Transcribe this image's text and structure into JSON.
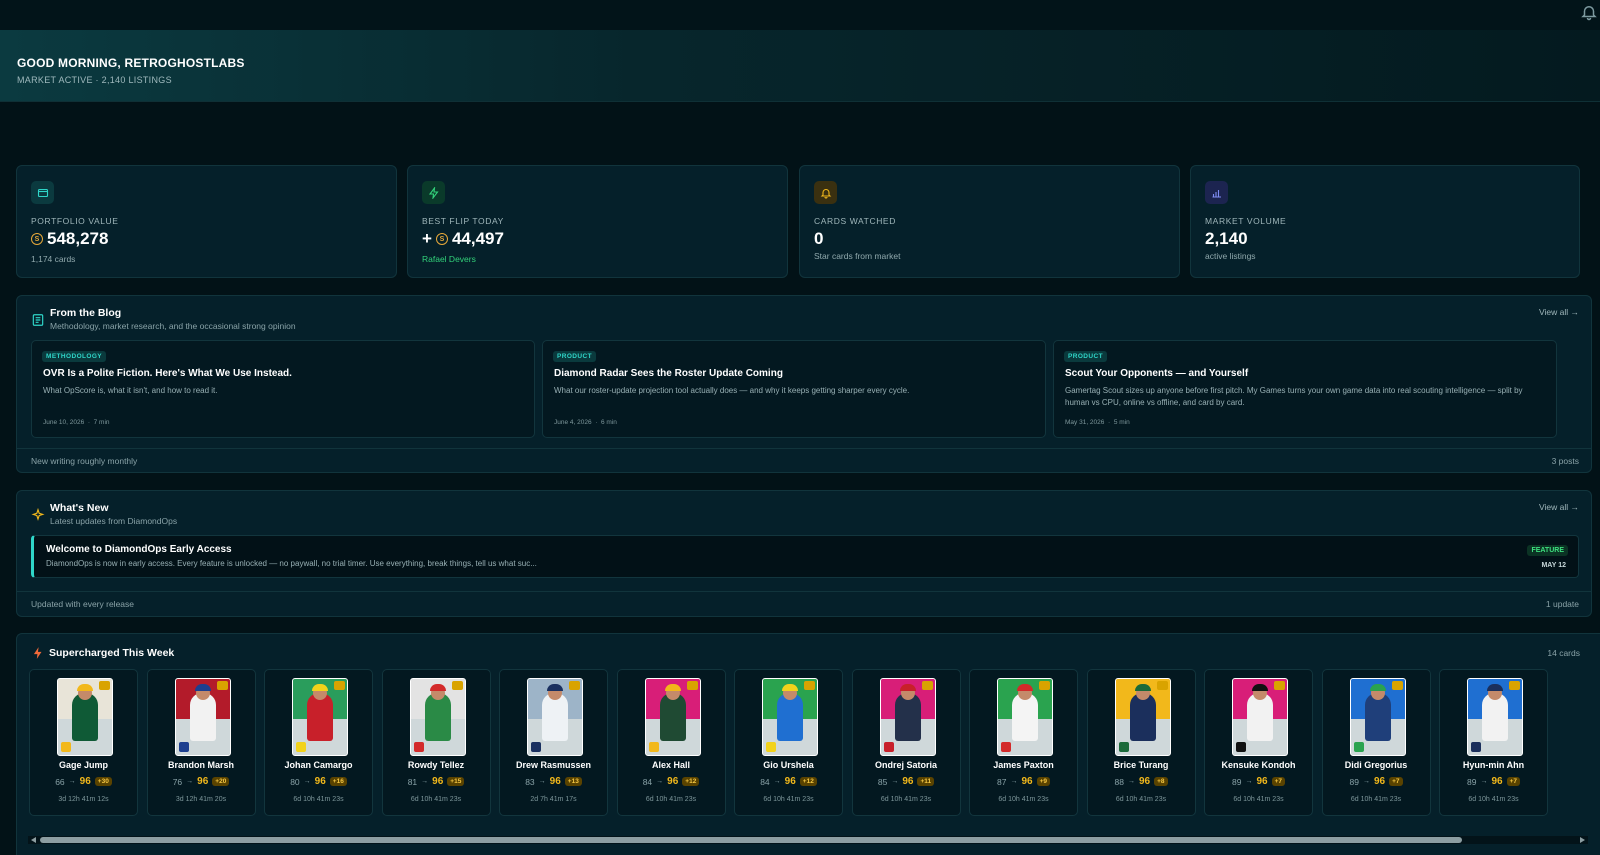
{
  "header": {
    "greeting": "GOOD MORNING, RETROGHOSTLABS",
    "status": "MARKET ACTIVE · 2,140 LISTINGS",
    "notification_icon": "bell-icon"
  },
  "stats": [
    {
      "icon": "wallet-icon",
      "label": "PORTFOLIO VALUE",
      "prefix": "",
      "value": "548,278",
      "has_coin": true,
      "sub": "1,174 cards"
    },
    {
      "icon": "lightning-icon",
      "label": "BEST FLIP TODAY",
      "prefix": "+",
      "value": "44,497",
      "has_coin": true,
      "sub": "Rafael Devers"
    },
    {
      "icon": "bell-icon",
      "label": "CARDS WATCHED",
      "prefix": "",
      "value": "0",
      "has_coin": false,
      "sub": "Star cards from market"
    },
    {
      "icon": "bar-chart-icon",
      "label": "MARKET VOLUME",
      "prefix": "",
      "value": "2,140",
      "has_coin": false,
      "sub": "active listings"
    }
  ],
  "blog": {
    "title": "From the Blog",
    "subtitle": "Methodology, market research, and the occasional strong opinion",
    "view_all": "View all →",
    "posts": [
      {
        "tag": "METHODOLOGY",
        "title": "OVR Is a Polite Fiction. Here's What We Use Instead.",
        "desc": "What OpScore is, what it isn't, and how to read it.",
        "date": "June 10, 2026",
        "read": "7 min"
      },
      {
        "tag": "PRODUCT",
        "title": "Diamond Radar Sees the Roster Update Coming",
        "desc": "What our roster-update projection tool actually does — and why it keeps getting sharper every cycle.",
        "date": "June 4, 2026",
        "read": "6 min"
      },
      {
        "tag": "PRODUCT",
        "title": "Scout Your Opponents — and Yourself",
        "desc": "Gamertag Scout sizes up anyone before first pitch. My Games turns your own game data into real scouting intelligence — split by human vs CPU, online vs offline, and card by card.",
        "date": "May 31, 2026",
        "read": "5 min"
      }
    ],
    "footer_left": "New writing roughly monthly",
    "footer_right": "3 posts",
    "separator": "·"
  },
  "whats_new": {
    "title": "What's New",
    "subtitle": "Latest updates from DiamondOps",
    "view_all": "View all →",
    "item": {
      "title": "Welcome to DiamondOps Early Access",
      "desc": "DiamondOps is now in early access. Every feature is unlocked — no paywall, no trial timer. Use everything, break things, tell us what suc...",
      "tag": "FEATURE",
      "date": "MAY 12"
    },
    "footer_left": "Updated with every release",
    "footer_right": "1 update"
  },
  "supercharged": {
    "title": "Supercharged This Week",
    "count": "14 cards",
    "arrow": "→",
    "cards": [
      {
        "name": "Gage Jump",
        "from": "66",
        "to": "96",
        "delta": "+30",
        "time": "3d 12h 41m 12s",
        "team_color": "#0f5a36",
        "band": "#e8e4d8",
        "accent": "#f2b81b"
      },
      {
        "name": "Brandon Marsh",
        "from": "76",
        "to": "96",
        "delta": "+20",
        "time": "3d 12h 41m 20s",
        "team_color": "#f2f2f2",
        "band": "#b31b2a",
        "accent": "#1d3f8f"
      },
      {
        "name": "Johan Camargo",
        "from": "80",
        "to": "96",
        "delta": "+16",
        "time": "6d 10h 41m 23s",
        "team_color": "#c8202a",
        "band": "#2a9d5c",
        "accent": "#f2d21b"
      },
      {
        "name": "Rowdy Tellez",
        "from": "81",
        "to": "96",
        "delta": "+15",
        "time": "6d 10h 41m 23s",
        "team_color": "#2a8a46",
        "band": "#e3e3e3",
        "accent": "#d32a2a"
      },
      {
        "name": "Drew Rasmussen",
        "from": "83",
        "to": "96",
        "delta": "+13",
        "time": "2d 7h 41m 17s",
        "team_color": "#eef2f5",
        "band": "#9db4c8",
        "accent": "#1a3060"
      },
      {
        "name": "Alex Hall",
        "from": "84",
        "to": "96",
        "delta": "+12",
        "time": "6d 10h 41m 23s",
        "team_color": "#1f4a33",
        "band": "#d81e78",
        "accent": "#f2b81b"
      },
      {
        "name": "Gio Urshela",
        "from": "84",
        "to": "96",
        "delta": "+12",
        "time": "6d 10h 41m 23s",
        "team_color": "#1f6fd1",
        "band": "#2aa34f",
        "accent": "#f2d21b"
      },
      {
        "name": "Ondrej Satoria",
        "from": "85",
        "to": "96",
        "delta": "+11",
        "time": "6d 10h 41m 23s",
        "team_color": "#23304a",
        "band": "#d81e78",
        "accent": "#c8202a"
      },
      {
        "name": "James Paxton",
        "from": "87",
        "to": "96",
        "delta": "+9",
        "time": "6d 10h 41m 23s",
        "team_color": "#f4f4f4",
        "band": "#2aa34f",
        "accent": "#d32a2a"
      },
      {
        "name": "Brice Turang",
        "from": "88",
        "to": "96",
        "delta": "+8",
        "time": "6d 10h 41m 23s",
        "team_color": "#1b2f5c",
        "band": "#f2b81b",
        "accent": "#1b6a3a"
      },
      {
        "name": "Kensuke Kondoh",
        "from": "89",
        "to": "96",
        "delta": "+7",
        "time": "6d 10h 41m 23s",
        "team_color": "#f2f2f2",
        "band": "#d81e78",
        "accent": "#111111"
      },
      {
        "name": "Didi Gregorius",
        "from": "89",
        "to": "96",
        "delta": "+7",
        "time": "6d 10h 41m 23s",
        "team_color": "#1f3f7a",
        "band": "#1f6fd1",
        "accent": "#2aa34f"
      },
      {
        "name": "Hyun-min Ahn",
        "from": "89",
        "to": "96",
        "delta": "+7",
        "time": "6d 10h 41m 23s",
        "team_color": "#f2f2f2",
        "band": "#1f6fd1",
        "accent": "#1b2f5c"
      }
    ]
  },
  "colors": {
    "accent_teal": "#2fd6c9",
    "gold": "#f2b81b",
    "green": "#32d27a"
  }
}
